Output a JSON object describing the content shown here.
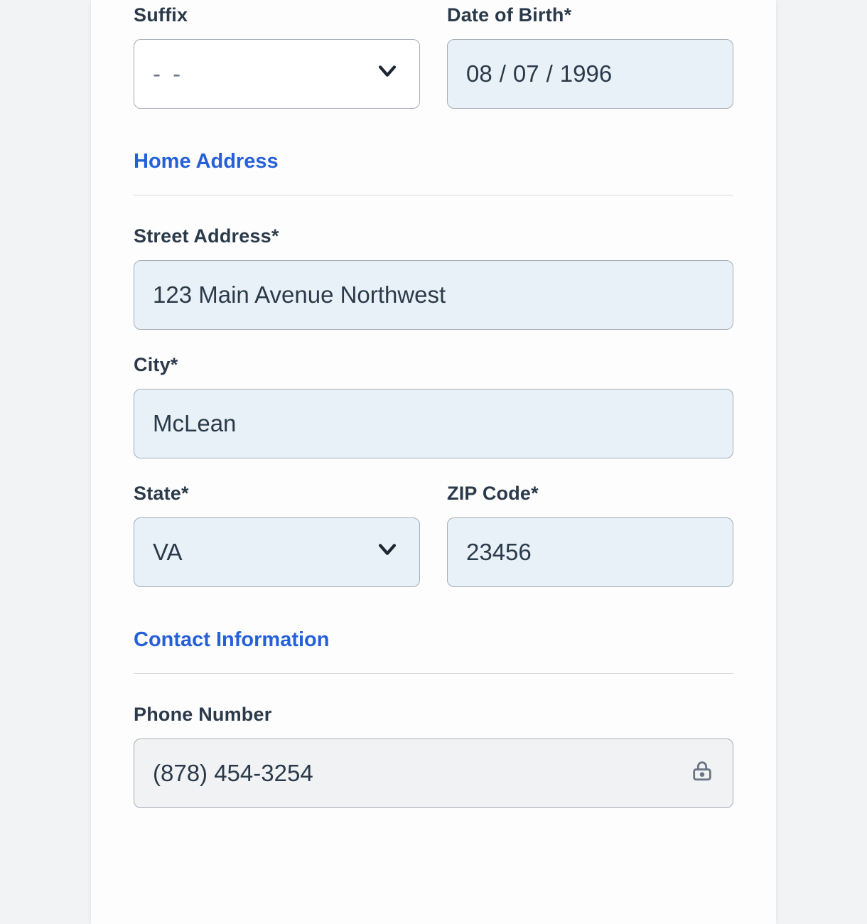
{
  "personal": {
    "suffix_label": "Suffix",
    "suffix_placeholder": "- -",
    "dob_label": "Date of Birth*",
    "dob": {
      "mm": "08",
      "dd": "07",
      "yyyy": "1996"
    }
  },
  "address": {
    "section_title": "Home Address",
    "street_label": "Street Address*",
    "street_value": "123 Main Avenue Northwest",
    "city_label": "City*",
    "city_value": "McLean",
    "state_label": "State*",
    "state_value": "VA",
    "zip_label": "ZIP Code*",
    "zip_value": "23456"
  },
  "contact": {
    "section_title": "Contact Information",
    "phone_label": "Phone Number",
    "phone_value": "(878) 454-3254"
  }
}
